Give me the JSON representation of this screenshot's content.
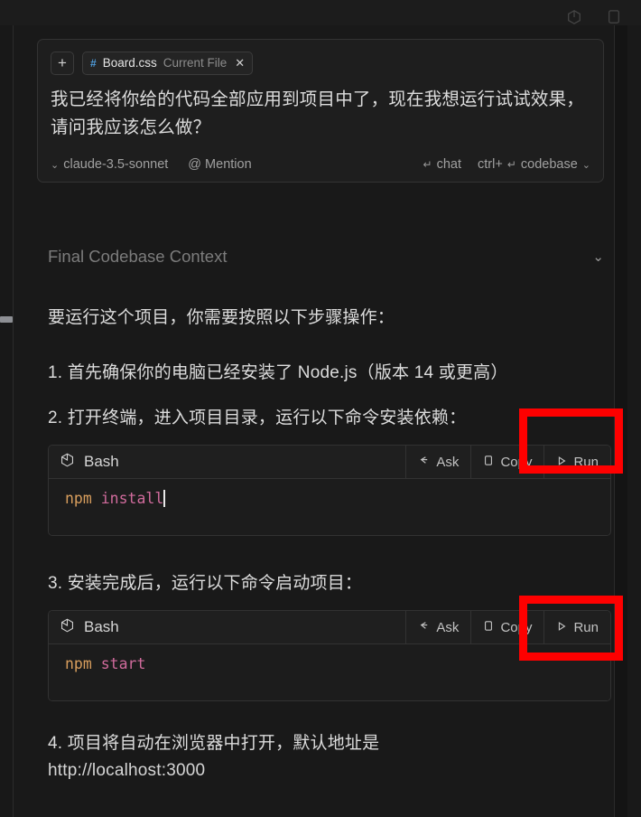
{
  "toolbar": {
    "icons": [
      "box-icon",
      "panel-icon"
    ]
  },
  "composer": {
    "add_button_label": "+",
    "file_chip": {
      "hash": "#",
      "filename": "Board.css",
      "subtitle": "Current File",
      "close_label": "✕"
    },
    "message": "我已经将你给的代码全部应用到项目中了，现在我想运行试试效果，请问我应该怎么做？",
    "model": "claude-3.5-sonnet",
    "model_caret": "⌄",
    "mention": "@ Mention",
    "chat_mode": "chat",
    "codebase_mode": "codebase",
    "codebase_shortcut": "ctrl+",
    "codebase_caret": "⌄",
    "return_key_glyph": "↵"
  },
  "context": {
    "title": "Final Codebase Context",
    "caret": "⌄"
  },
  "answer": {
    "intro": "要运行这个项目，你需要按照以下步骤操作：",
    "step1": "1. 首先确保你的电脑已经安装了 Node.js（版本 14 或更高）",
    "step2": "2. 打开终端，进入项目目录，运行以下命令安装依赖：",
    "step3": "3. 安装完成后，运行以下命令启动项目：",
    "step4": "4. 项目将自动在浏览器中打开，默认地址是",
    "step4_url": "http://localhost:3000"
  },
  "code_blocks": [
    {
      "lang": "Bash",
      "ask_label": "Ask",
      "copy_label": "Copy",
      "run_label": "Run",
      "cmd": "npm",
      "arg": "install",
      "has_cursor": true
    },
    {
      "lang": "Bash",
      "ask_label": "Ask",
      "copy_label": "Copy",
      "run_label": "Run",
      "cmd": "npm",
      "arg": "start",
      "has_cursor": false
    }
  ],
  "annotations": {
    "color": "#fe0000",
    "boxes": [
      "run-button-highlight-1",
      "run-button-highlight-2"
    ]
  }
}
